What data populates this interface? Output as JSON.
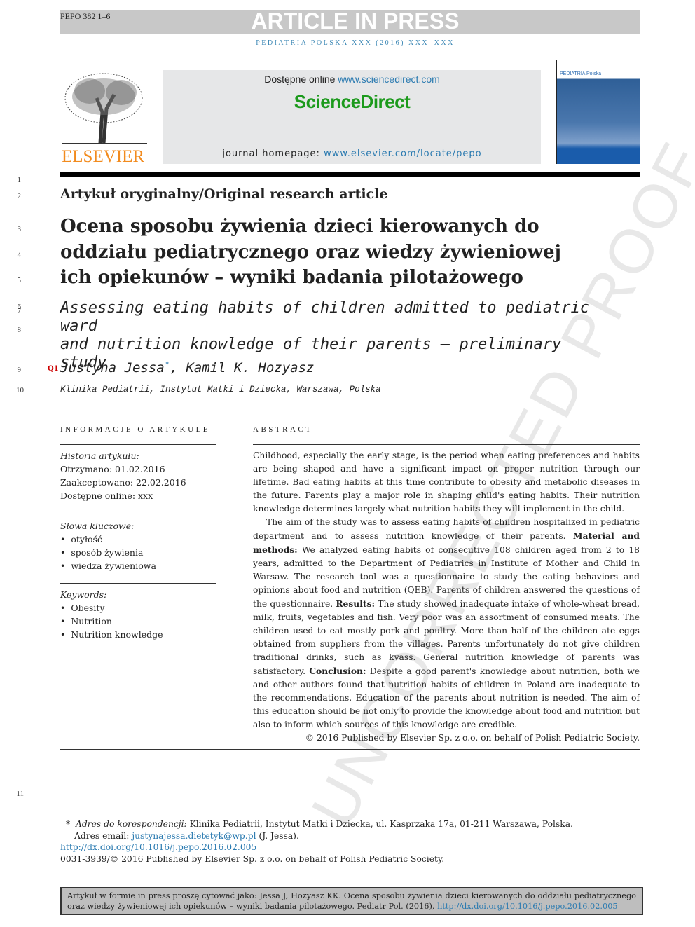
{
  "header": {
    "pepo": "PEPO 382 1–6",
    "article_in_press": "ARTICLE IN PRESS",
    "journal": "PEDIATRIA POLSKA XXX (2016) XXX–XXX",
    "available_prefix": "Dostępne online ",
    "available_link": "www.sciencedirect.com",
    "sciencedirect": "ScienceDirect",
    "homepage_prefix": "journal homepage: ",
    "homepage_link": "www.elsevier.com/locate/pepo",
    "publisher": "ELSEVIER",
    "cover_title": "PEDIATRIA Polska"
  },
  "line_numbers": [
    "1",
    "2",
    "3",
    "4",
    "5",
    "6",
    "7",
    "8",
    "9",
    "10",
    "11"
  ],
  "article": {
    "kind": "Artykuł oryginalny/Original research article",
    "title_lines": [
      "Ocena sposobu żywienia dzieci kierowanych do",
      "oddziału pediatrycznego oraz wiedzy żywieniowej",
      "ich opiekunów – wyniki badania pilotażowego"
    ],
    "english_title_lines": [
      "Assessing eating habits of children admitted to pediatric ward",
      "and nutrition knowledge of their parents – preliminary study"
    ],
    "query_mark": "Q1",
    "author1": "Justyna Jessa",
    "author_star": "*",
    "author2": ", Kamil K. Hozyasz",
    "affiliation": "Klinika Pediatrii, Instytut Matki i Dziecka, Warszawa, Polska"
  },
  "info": {
    "heading": "INFORMACJE O ARTYKULE",
    "history_label": "Historia artykułu:",
    "history": [
      "Otrzymano: 01.02.2016",
      "Zaakceptowano: 22.02.2016",
      "Dostępne online: xxx"
    ],
    "keywords_pl_label": "Słowa kluczowe:",
    "keywords_pl": [
      "otyłość",
      "sposób żywienia",
      "wiedza żywieniowa"
    ],
    "keywords_en_label": "Keywords:",
    "keywords_en": [
      "Obesity",
      "Nutrition",
      "Nutrition knowledge"
    ]
  },
  "abstract": {
    "heading": "ABSTRACT",
    "p1": "Childhood, especially the early stage, is the period when eating preferences and habits are being shaped and have a significant impact on proper nutrition through our lifetime. Bad eating habits at this time contribute to obesity and metabolic diseases in the future. Parents play a major role in shaping child's eating habits. Their nutrition knowledge determines largely what nutrition habits they will implement in the child.",
    "p2": [
      "The aim of the study was to assess eating habits of children hospitalized in pediatric department and to assess nutrition knowledge of their parents. ",
      "Material and methods:",
      " We analyzed eating habits of consecutive 108 children aged from 2 to 18 years, admitted to the Department of Pediatrics in Institute of Mother and Child in Warsaw. The research tool was a questionnaire to study the eating behaviors and opinions about food and nutrition (QEB). Parents of children answered the questions of the questionnaire. ",
      "Results:",
      " The study showed inadequate intake of whole-wheat bread, milk, fruits, vegetables and fish. Very poor was an assortment of consumed meats. The children used to eat mostly pork and poultry. More than half of the children ate eggs obtained from suppliers from the villages. Parents unfortunately do not give children traditional drinks, such as kvass. General nutrition knowledge of parents was satisfactory. ",
      "Conclusion:",
      " Despite a good parent's knowledge about nutrition, both we and other authors found that nutrition habits of children in Poland are inadequate to the recommendations. Education of the parents about nutrition is needed. The aim of this education should be not only to provide the knowledge about food and nutrition but also to inform which sources of this knowledge are credible."
    ],
    "copyright": "© 2016 Published by Elsevier Sp. z o.o. on behalf of Polish Pediatric Society."
  },
  "footnote": {
    "star": "*",
    "corr_label": "Adres do korespondencji:",
    "corr": " Klinika Pediatrii, Instytut Matki i Dziecka, ul. Kasprzaka 17a, 01-211 Warszawa, Polska.",
    "email_label": "Adres email: ",
    "email": "justynajessa.dietetyk@wp.pl",
    "email_suffix": " (J. Jessa).",
    "doi": "http://dx.doi.org/10.1016/j.pepo.2016.02.005",
    "issn": "0031-3939/© 2016 Published by Elsevier Sp. z o.o. on behalf of Polish Pediatric Society."
  },
  "citation": {
    "text": "Artykuł w formie in press proszę cytować jako: Jessa J, Hozyasz KK. Ocena sposobu żywienia dzieci kierowanych do oddziału pediatrycznego oraz wiedzy żywieniowej ich opiekunów – wyniki badania pilotażowego. Pediatr Pol. (2016), ",
    "link": "http://dx.doi.org/10.1016/j.pepo.2016.02.005"
  },
  "watermark": "UNCORRECTED PROOF"
}
